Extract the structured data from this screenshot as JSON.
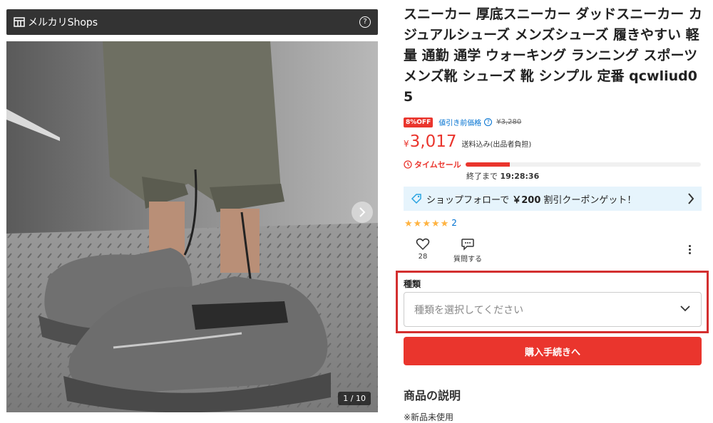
{
  "gallery": {
    "header": "メルカリShops",
    "help": "?",
    "counter": "1 / 10"
  },
  "product": {
    "title": "スニーカー 厚底スニーカー ダッドスニーカー カジュアルシューズ メンズシューズ 履きやすい 軽量 通勤 通学 ウォーキング ランニング スポーツ メンズ靴 シューズ 靴 シンプル 定番 qcwliud05",
    "discount_badge": "8%OFF",
    "pre_discount_label": "値引き前価格",
    "old_price": "¥3,280",
    "currency": "¥",
    "price": "3,017",
    "shipping_note": "送料込み(出品者負担)"
  },
  "timesale": {
    "label": "タイムセール",
    "progress": 0.19,
    "ends_prefix": "終了まで",
    "ends_time": "19:28:36"
  },
  "coupon": {
    "text_before": "ショップフォローで",
    "amount": "￥200",
    "text_after": "割引クーポンゲット！"
  },
  "rating": {
    "stars": 5,
    "count": "2"
  },
  "actions": {
    "like_count": "28",
    "question_label": "質問する"
  },
  "variant": {
    "label": "種類",
    "placeholder": "種類を選択してください"
  },
  "buy": {
    "label": "購入手続きへ"
  },
  "description": {
    "title": "商品の説明",
    "first_line": "※新品未使用"
  },
  "colors": {
    "accent_red": "#ea352d",
    "link_blue": "#0071d1",
    "coupon_bg": "#e6f4fc",
    "star": "#ffb340",
    "highlight_box": "#d32f2f"
  }
}
